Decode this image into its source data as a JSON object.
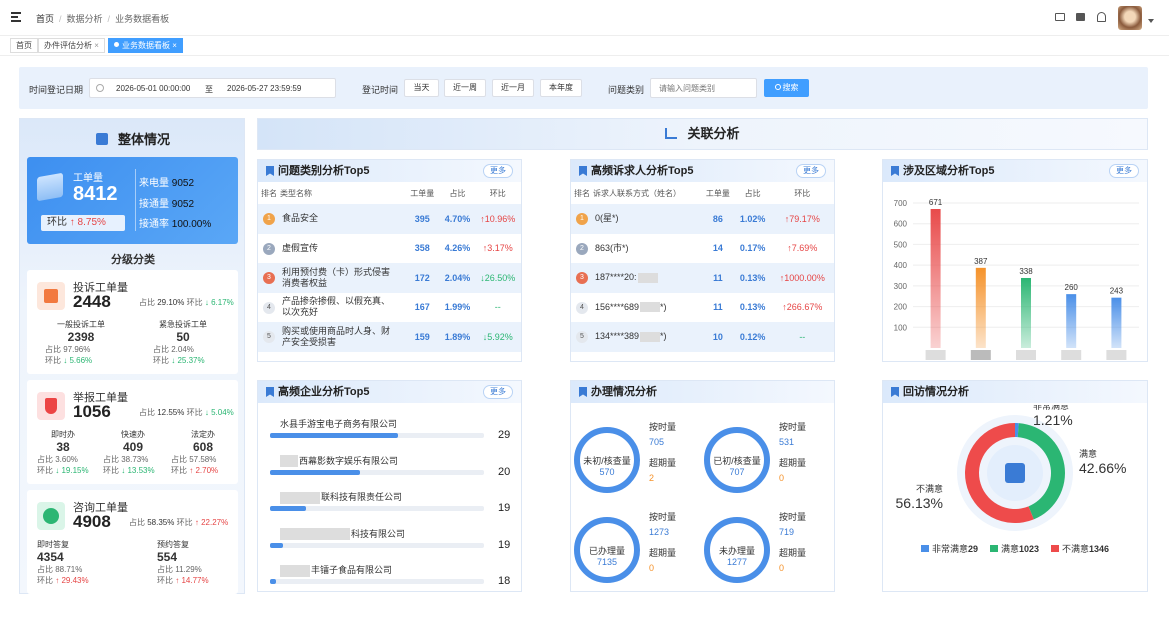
{
  "breadcrumb": {
    "home": "首页",
    "sep": "/",
    "l2": "数据分析",
    "l3": "业务数据看板"
  },
  "tabs": [
    {
      "label": "首页"
    },
    {
      "label": "办件评估分析",
      "close": "×"
    },
    {
      "label": "业务数据看板",
      "close": "×"
    }
  ],
  "filter": {
    "date_label": "时间登记日期",
    "start": "2026-05-01 00:00:00",
    "to": "至",
    "end": "2026-05-27 23:59:59",
    "reg_label": "登记时间",
    "btns": [
      "当天",
      "近一周",
      "近一月",
      "本年度"
    ],
    "type_label": "问题类别",
    "type_placeholder": "请输入问题类别",
    "search": "搜索"
  },
  "overall": {
    "title": "整体情况",
    "work_label": "工单量",
    "work_value": "8412",
    "ratio_label": "环比",
    "ratio_value": "↑ 8.75%",
    "calls_label": "来电量",
    "calls": "9052",
    "connect_label": "接通量",
    "connect": "9052",
    "rate_label": "接通率",
    "rate": "100.00%",
    "cat_title": "分级分类",
    "complaint": {
      "title": "投诉工单量",
      "value": "2448",
      "share_label": "占比",
      "share": "29.10%",
      "ratio_label": "环比",
      "ratio": "↓ 6.17%",
      "subs": [
        {
          "name": "一般投诉工单",
          "value": "2398",
          "share": "97.96%",
          "ratio": "↓ 5.66%"
        },
        {
          "name": "紧急投诉工单",
          "value": "50",
          "share": "2.04%",
          "ratio": "↓ 25.37%"
        }
      ]
    },
    "report": {
      "title": "举报工单量",
      "value": "1056",
      "share_label": "占比",
      "share": "12.55%",
      "ratio_label": "环比",
      "ratio": "↓ 5.04%",
      "subs": [
        {
          "name": "即时办",
          "value": "38",
          "share": "3.60%",
          "ratio": "↓ 19.15%"
        },
        {
          "name": "快速办",
          "value": "409",
          "share": "38.73%",
          "ratio": "↓ 13.53%"
        },
        {
          "name": "法定办",
          "value": "608",
          "share": "57.58%",
          "ratio": "↑ 2.70%"
        }
      ]
    },
    "consult": {
      "title": "咨询工单量",
      "value": "4908",
      "share_label": "占比",
      "share": "58.35%",
      "ratio_label": "环比",
      "ratio": "↑ 22.27%",
      "subs": [
        {
          "name": "即时答复",
          "value": "4354",
          "share": "88.71%",
          "ratio": "↑ 29.43%"
        },
        {
          "name": "预约答复",
          "value": "554",
          "share": "11.29%",
          "ratio": "↑ 14.77%"
        }
      ]
    }
  },
  "sub_share_label": "占比",
  "sub_ratio_label": "环比",
  "assoc": {
    "title": "关联分析"
  },
  "more": "更多",
  "problem_top5": {
    "title": "问题类别分析Top5",
    "headers": [
      "排名",
      "类型名称",
      "工单量",
      "占比",
      "环比"
    ],
    "rows": [
      {
        "rank": "1",
        "name": "食品安全",
        "count": "395",
        "share": "4.70%",
        "ratio": "↑10.96%",
        "dir": "up"
      },
      {
        "rank": "2",
        "name": "虚假宣传",
        "count": "358",
        "share": "4.26%",
        "ratio": "↑3.17%",
        "dir": "up"
      },
      {
        "rank": "3",
        "name": "利用预付费（卡）形式侵害消费者权益",
        "count": "172",
        "share": "2.04%",
        "ratio": "↓26.50%",
        "dir": "down"
      },
      {
        "rank": "4",
        "name": "产品掺杂掺假、以假充真、以次充好",
        "count": "167",
        "share": "1.99%",
        "ratio": "--",
        "dir": "flat"
      },
      {
        "rank": "5",
        "name": "购买或使用商品时人身、财产安全受损害",
        "count": "159",
        "share": "1.89%",
        "ratio": "↓5.92%",
        "dir": "down"
      }
    ]
  },
  "complainant_top5": {
    "title": "高频诉求人分析Top5",
    "headers": [
      "排名",
      "诉求人联系方式（姓名）",
      "工单量",
      "占比",
      "环比"
    ],
    "rows": [
      {
        "rank": "1",
        "name": "0(星*)",
        "count": "86",
        "share": "1.02%",
        "ratio": "↑79.17%",
        "dir": "up"
      },
      {
        "rank": "2",
        "name": "863(市*)",
        "count": "14",
        "share": "0.17%",
        "ratio": "↑7.69%",
        "dir": "up"
      },
      {
        "rank": "3",
        "name": "187****20:",
        "count": "11",
        "share": "0.13%",
        "ratio": "↑1000.00%",
        "dir": "up"
      },
      {
        "rank": "4",
        "name": "156****689",
        "name_tail": "*)",
        "count": "11",
        "share": "0.13%",
        "ratio": "↑266.67%",
        "dir": "up"
      },
      {
        "rank": "5",
        "name": "134****389",
        "name_tail": "*)",
        "count": "10",
        "share": "0.12%",
        "ratio": "--",
        "dir": "flat"
      }
    ]
  },
  "region_top5": {
    "title": "涉及区域分析Top5"
  },
  "chart_data": {
    "type": "bar",
    "categories": [
      "",
      "",
      "",
      "",
      ""
    ],
    "values": [
      671,
      387,
      338,
      260,
      243
    ],
    "ylim": [
      0,
      700
    ],
    "yticks": [
      100,
      200,
      300,
      400,
      500,
      600,
      700
    ],
    "colors": [
      "#e84a4a",
      "#f5922a",
      "#2bb673",
      "#4a8fe8",
      "#4a8fe8"
    ]
  },
  "enterprise_top5": {
    "title": "高频企业分析Top5",
    "rows": [
      {
        "name": "水县手游宝电子商务有限公司",
        "value": "29",
        "ratio": 0.6
      },
      {
        "name": "西幕影数字娱乐有限公司",
        "value": "20",
        "ratio": 0.42
      },
      {
        "name": "联科技有限责任公司",
        "value": "19",
        "ratio": 0.17
      },
      {
        "name": "科技有限公司",
        "value": "19",
        "ratio": 0.06
      },
      {
        "name": "丰镭子食品有限公司",
        "value": "18",
        "ratio": 0.03
      }
    ]
  },
  "handling": {
    "title": "办理情况分析",
    "ontime": "按时量",
    "overtime": "超期量",
    "rings": [
      {
        "name": "未初/核查量",
        "value": "570",
        "ontime": "705",
        "overtime": "2"
      },
      {
        "name": "已初/核查量",
        "value": "707",
        "ontime": "531",
        "overtime": "0"
      },
      {
        "name": "已办理量",
        "value": "7135",
        "ontime": "1273",
        "overtime": "0"
      },
      {
        "name": "未办理量",
        "value": "1277",
        "ontime": "719",
        "overtime": "0"
      }
    ]
  },
  "visit": {
    "title": "回访情况分析",
    "slices": [
      {
        "name": "非常满意",
        "pct": "1.21%",
        "count": "29",
        "color": "#4a8fe8",
        "value": 1.21
      },
      {
        "name": "满意",
        "pct": "42.66%",
        "count": "1023",
        "color": "#2bb673",
        "value": 42.66
      },
      {
        "name": "不满意",
        "pct": "56.13%",
        "count": "1346",
        "color": "#ee4b4b",
        "value": 56.13
      }
    ]
  }
}
